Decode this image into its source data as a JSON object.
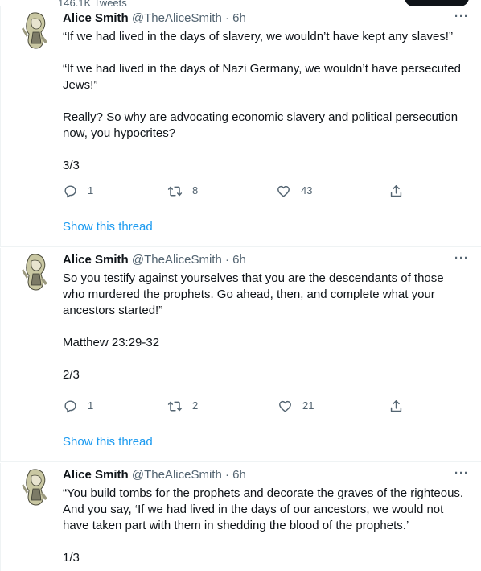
{
  "header": {
    "tweet_count": "146.1K Tweets"
  },
  "tweets": [
    {
      "author_name": "Alice Smith",
      "handle": "@TheAliceSmith",
      "separator": "·",
      "time": "6h",
      "paragraphs": [
        "“If we had lived in the days of slavery, we wouldn’t have kept any slaves!”",
        "“If we had lived in the days of Nazi Germany, we wouldn’t have persecuted\nJews!”",
        "Really? So why are advocating economic slavery and political persecution\nnow, you hypocrites?",
        "3/3"
      ],
      "replies": "1",
      "retweets": "8",
      "likes": "43",
      "show_thread": "Show this thread"
    },
    {
      "author_name": "Alice Smith",
      "handle": "@TheAliceSmith",
      "separator": "·",
      "time": "6h",
      "paragraphs": [
        "So you testify against yourselves that you are the descendants of those\nwho murdered the prophets. Go ahead, then, and complete what your\nancestors started!”",
        "Matthew 23:29-32",
        "2/3"
      ],
      "replies": "1",
      "retweets": "2",
      "likes": "21",
      "show_thread": "Show this thread"
    },
    {
      "author_name": "Alice Smith",
      "handle": "@TheAliceSmith",
      "separator": "·",
      "time": "6h",
      "paragraphs": [
        "“You build tombs for the prophets and decorate the graves of the righteous.\nAnd you say, ‘If we had lived in the days of our ancestors, we would not\nhave taken part with them in shedding the blood of the prophets.’",
        "1/3"
      ]
    }
  ],
  "icons": {
    "reply": "reply-icon",
    "retweet": "retweet-icon",
    "like": "heart-icon",
    "share": "share-icon",
    "more": "more-icon",
    "avatar": "avatar"
  },
  "colors": {
    "accent": "#1d9bf0",
    "text": "#0f1419",
    "secondary": "#536471",
    "border": "#eff3f4"
  }
}
